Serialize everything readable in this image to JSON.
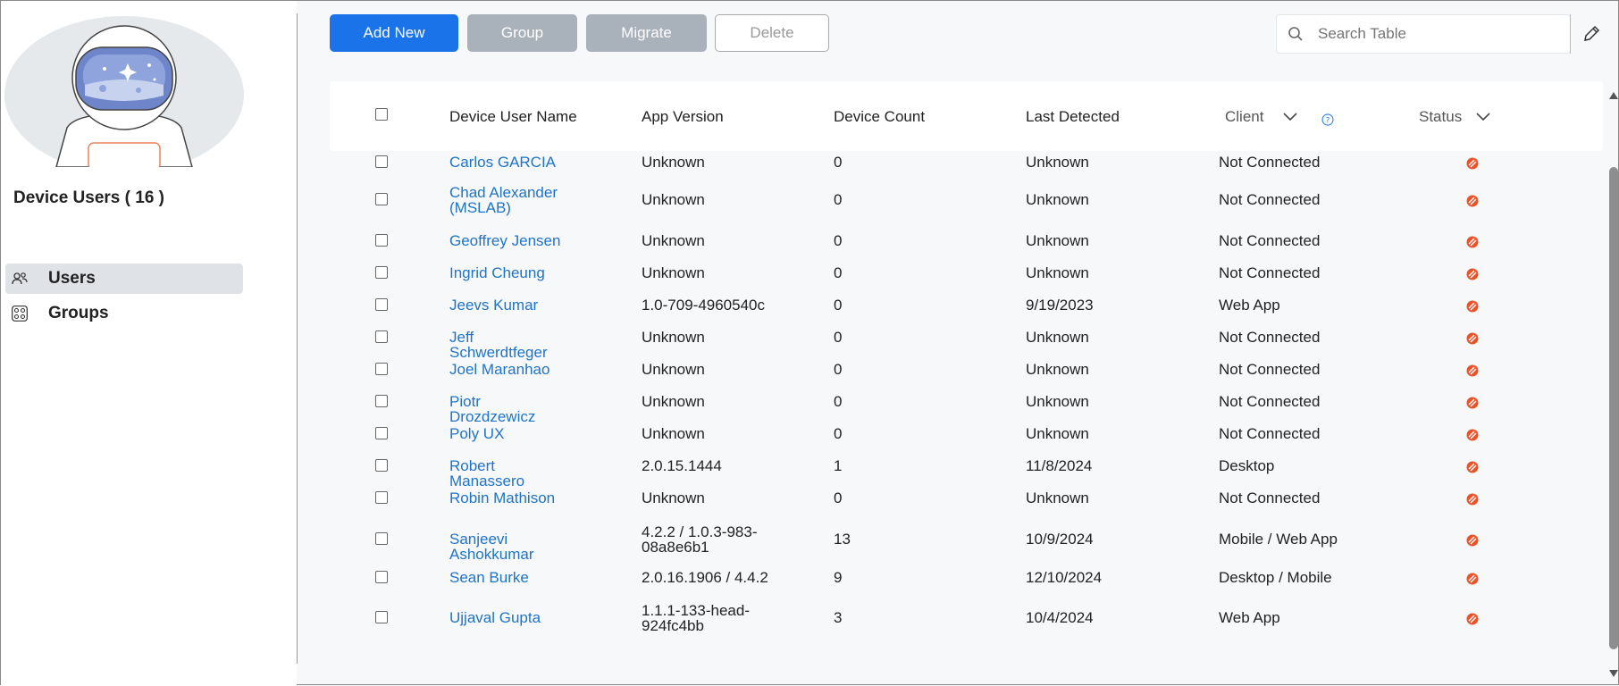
{
  "sidebar": {
    "title": "Device Users ( 16 )",
    "nav": [
      {
        "label": "Users",
        "icon": "users-icon",
        "active": true
      },
      {
        "label": "Groups",
        "icon": "groups-icon",
        "active": false
      }
    ]
  },
  "toolbar": {
    "add_new": "Add New",
    "group": "Group",
    "migrate": "Migrate",
    "delete": "Delete",
    "search_placeholder": "Search Table"
  },
  "table": {
    "headers": {
      "name": "Device User Name",
      "app_version": "App Version",
      "device_count": "Device Count",
      "last_detected": "Last Detected",
      "client": "Client",
      "status": "Status"
    },
    "rows": [
      {
        "name": "Carlos GARCIA",
        "app_version": "Unknown",
        "device_count": "0",
        "last_detected": "Unknown",
        "client": "Not Connected"
      },
      {
        "name": "Chad Alexander (MSLAB)",
        "app_version": "Unknown",
        "device_count": "0",
        "last_detected": "Unknown",
        "client": "Not Connected"
      },
      {
        "name": "Geoffrey Jensen",
        "app_version": "Unknown",
        "device_count": "0",
        "last_detected": "Unknown",
        "client": "Not Connected"
      },
      {
        "name": "Ingrid Cheung",
        "app_version": "Unknown",
        "device_count": "0",
        "last_detected": "Unknown",
        "client": "Not Connected"
      },
      {
        "name": "Jeevs Kumar",
        "app_version": "1.0-709-4960540c",
        "device_count": "0",
        "last_detected": "9/19/2023",
        "client": "Web App"
      },
      {
        "name": "Jeff Schwerdtfeger",
        "app_version": "Unknown",
        "device_count": "0",
        "last_detected": "Unknown",
        "client": "Not Connected"
      },
      {
        "name": "Joel Maranhao",
        "app_version": "Unknown",
        "device_count": "0",
        "last_detected": "Unknown",
        "client": "Not Connected"
      },
      {
        "name": "Piotr Drozdzewicz",
        "app_version": "Unknown",
        "device_count": "0",
        "last_detected": "Unknown",
        "client": "Not Connected"
      },
      {
        "name": "Poly UX",
        "app_version": "Unknown",
        "device_count": "0",
        "last_detected": "Unknown",
        "client": "Not Connected"
      },
      {
        "name": "Robert Manassero",
        "app_version": "2.0.15.1444",
        "device_count": "1",
        "last_detected": "11/8/2024",
        "client": "Desktop"
      },
      {
        "name": "Robin Mathison",
        "app_version": "Unknown",
        "device_count": "0",
        "last_detected": "Unknown",
        "client": "Not Connected"
      },
      {
        "name": "Sanjeevi Ashokkumar",
        "app_version": "4.2.2 / 1.0.3-983-08a8e6b1",
        "device_count": "13",
        "last_detected": "10/9/2024",
        "client": "Mobile / Web App"
      },
      {
        "name": "Sean Burke",
        "app_version": "2.0.16.1906 / 4.4.2",
        "device_count": "9",
        "last_detected": "12/10/2024",
        "client": "Desktop / Mobile"
      },
      {
        "name": "Ujjaval Gupta",
        "app_version": "1.1.1-133-head-924fc4bb",
        "device_count": "3",
        "last_detected": "10/4/2024",
        "client": "Web App"
      }
    ]
  },
  "colors": {
    "primary": "#1a73e8",
    "link": "#1f73c8",
    "status_disconnected": "#e8532a",
    "disabled": "#a9b1bb"
  }
}
